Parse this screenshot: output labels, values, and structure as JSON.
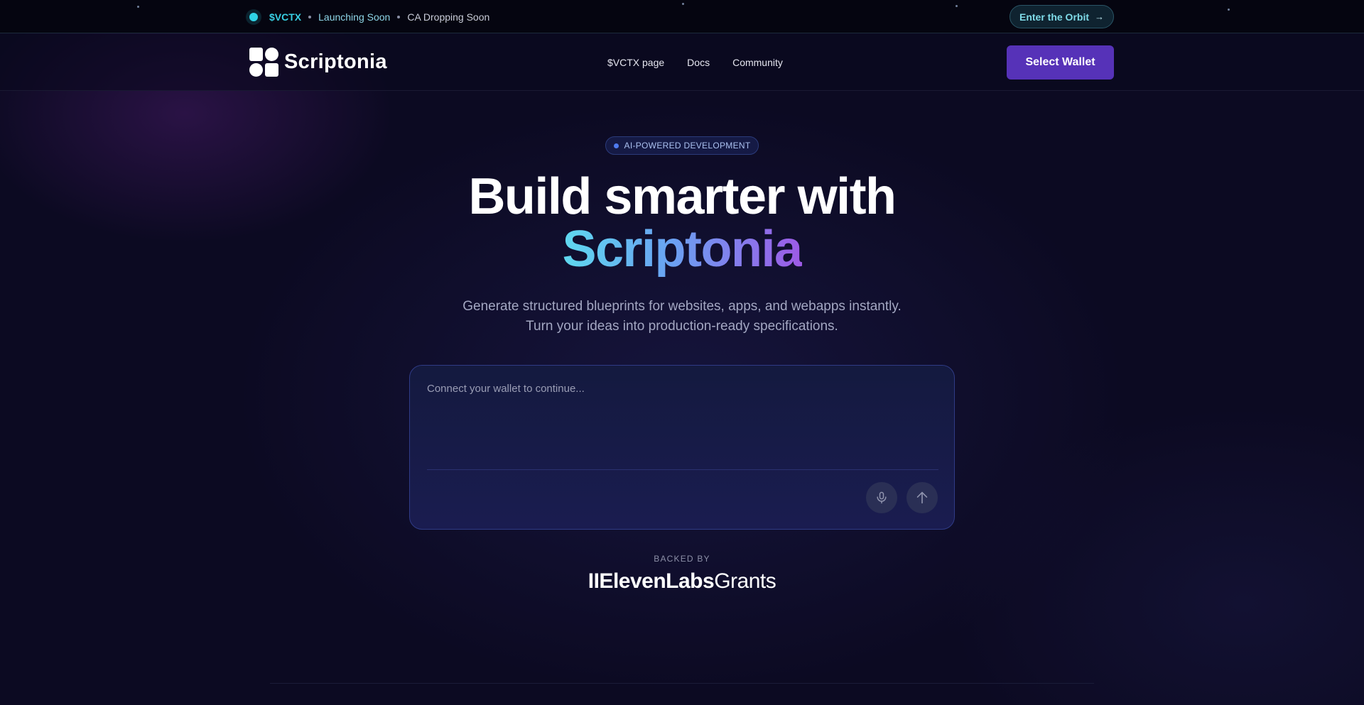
{
  "topbar": {
    "token": "$VCTX",
    "launch_status": "Launching Soon",
    "ca_status": "CA Dropping Soon",
    "orbit_button": "Enter the Orbit",
    "orbit_arrow": "→",
    "accent_color": "#2fd3e6"
  },
  "nav": {
    "brand": "Scriptonia",
    "links": [
      "$VCTX page",
      "Docs",
      "Community"
    ],
    "wallet_button": "Select Wallet",
    "wallet_color": "#5632b8"
  },
  "hero": {
    "badge": "AI-POWERED DEVELOPMENT",
    "title_line1": "Build smarter with",
    "title_line2": "Scriptonia",
    "subtitle_line1": "Generate structured blueprints for websites, apps, and webapps instantly.",
    "subtitle_line2": "Turn your ideas into production-ready specifications."
  },
  "prompt": {
    "placeholder": "Connect your wallet to continue...",
    "mic_icon": "microphone-icon",
    "send_icon": "arrow-up-icon"
  },
  "backed": {
    "label": "BACKED BY",
    "sponsor_bold": "IIElevenLabs",
    "sponsor_light": "Grants"
  }
}
